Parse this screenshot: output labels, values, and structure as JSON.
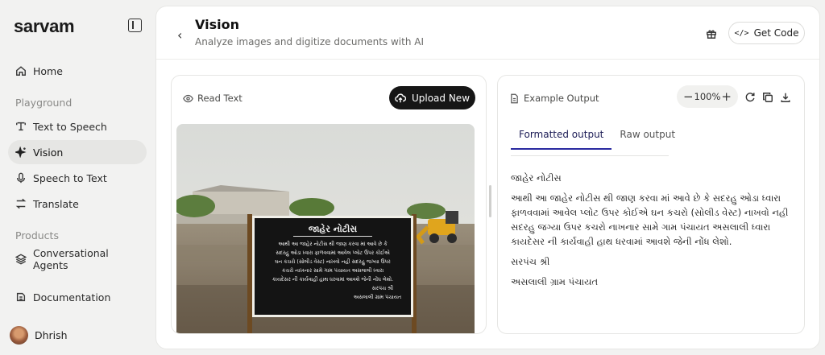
{
  "sidebar": {
    "logo": "sarvam",
    "nav_home": "Home",
    "section_playground": "Playground",
    "playground_items": [
      "Text to Speech",
      "Vision",
      "Speech to Text",
      "Translate"
    ],
    "section_products": "Products",
    "product_items": [
      "Conversational Agents"
    ],
    "documentation": "Documentation",
    "user_name": "Dhrish"
  },
  "header": {
    "title": "Vision",
    "subtitle": "Analyze images and digitize documents with AI",
    "get_code_label": "Get Code"
  },
  "input_panel": {
    "label": "Read Text",
    "upload_label": "Upload New",
    "sign_title": "જાહેર નોટીસ",
    "sign_lines": [
      "આથી આ જાહેર નોટીસ થી જાણ કરવા માં આવે છે કે",
      "સદરહુ ઓડા ધ્વારા ફાળવવામાં આવેલ પ્લોટ ઉપર કોઈએ",
      "ઘન કચરો (સોલીડ વેસ્ટ) નાખવો નહી સદરહુ જગ્યા ઉપર",
      "કચરો નાખનાર સામે ગામ પંચાયત અસલાલી ધ્વારા",
      "કાયદેસર ની કાર્યવાહી હાથ ધરવામાં આવશે જેની નોંધ લેશો.",
      "સરપંચ શ્રી",
      "અસલાલી ગ્રામ પંચાયત"
    ]
  },
  "output_panel": {
    "label": "Example Output",
    "zoom": "100%",
    "tabs": [
      "Formatted output",
      "Raw output"
    ],
    "active_tab": "Formatted output",
    "paragraphs": [
      "જાહેર નોટીસ",
      "આથી આ જાહેર નોટીસ થી જાણ કરવા માં આવે છે કે સદરહુ ઓડા ધ્વારા ફાળવવામાં આવેલ પ્લોટ ઉપર કોઈએ ઘન કચરો (સોલીડ વેસ્ટ) નાખવો નહી સદરહુ જગ્યા ઉપર કચરો નાખનાર સામે ગામ પંચાયત અસલાલી ધ્વારા કાયદેસર ની કાર્યવાહી હાથ ધરવામાં આવશે જેની નોંધ લેશો.",
      "સરપંચ શ્રી",
      "અસલાલી ગ્રામ પંચાયત"
    ]
  },
  "colors": {
    "accent": "#2a2aa0",
    "button_dark": "#161616",
    "sign_board": "#141414"
  }
}
